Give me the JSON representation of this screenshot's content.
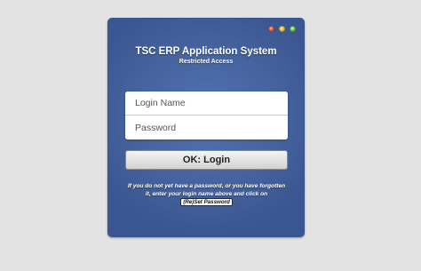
{
  "window": {
    "title": "TSC ERP Application System",
    "subtitle": "Restricted Access"
  },
  "window_controls": {
    "close_icon": "close-light-icon",
    "minimize_icon": "minimize-light-icon",
    "zoom_icon": "zoom-light-icon",
    "colors": {
      "close": "#e0463a",
      "minimize": "#e8b829",
      "zoom": "#67b83a"
    }
  },
  "form": {
    "login_name": {
      "placeholder": "Login Name",
      "value": ""
    },
    "password": {
      "placeholder": "Password",
      "value": ""
    },
    "login_button": "OK: Login"
  },
  "help": {
    "text": "If you do not yet have a password, or you have forgotten it, enter your login name above and click on",
    "reset_label": "(Re)Set Password"
  },
  "colors": {
    "window_background": "#46649f",
    "page_background": "#e3e3e3"
  }
}
